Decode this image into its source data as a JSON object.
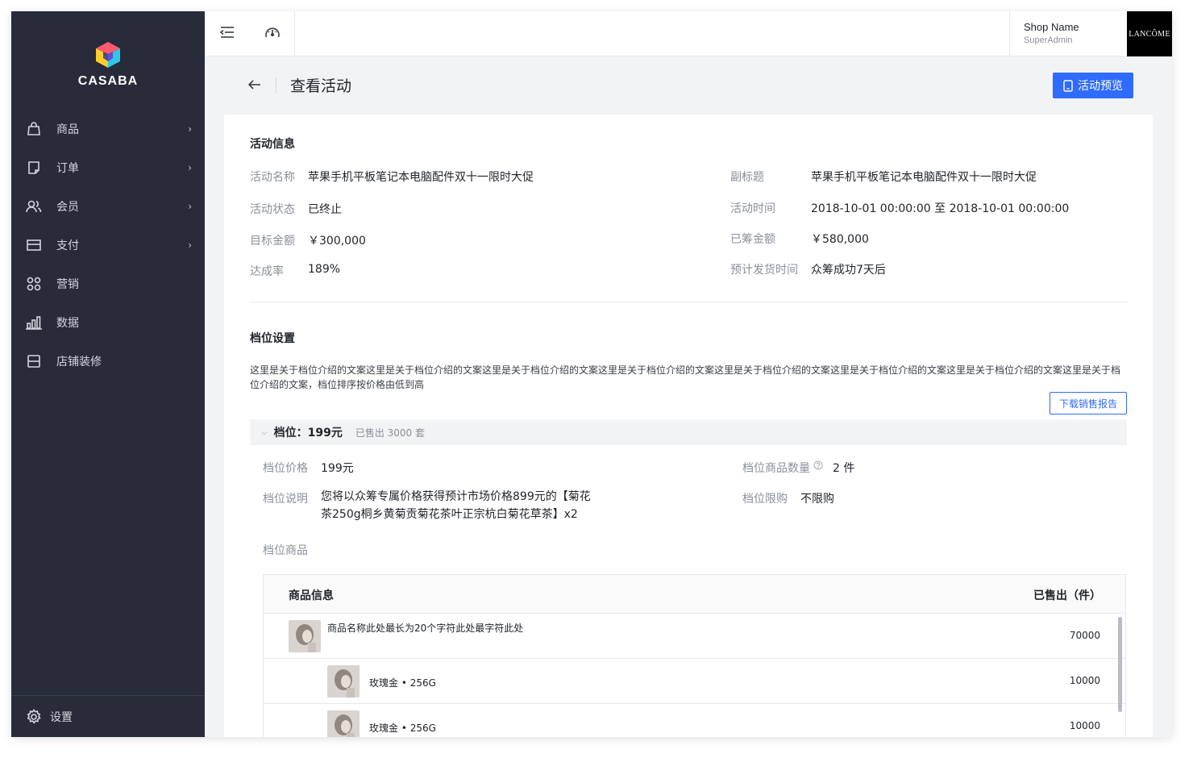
{
  "brand": {
    "logo_text": "CASABA"
  },
  "sidebar": {
    "items": [
      {
        "label": "商品",
        "icon": "shopping-bag-icon",
        "has_children": true
      },
      {
        "label": "订单",
        "icon": "order-doc-icon",
        "has_children": true
      },
      {
        "label": "会员",
        "icon": "members-icon",
        "has_children": true
      },
      {
        "label": "支付",
        "icon": "card-icon",
        "has_children": true
      },
      {
        "label": "营销",
        "icon": "apps-icon",
        "has_children": false
      },
      {
        "label": "数据",
        "icon": "bar-chart-icon",
        "has_children": false
      },
      {
        "label": "店铺装修",
        "icon": "layout-icon",
        "has_children": false
      }
    ],
    "settings_label": "设置"
  },
  "topbar": {
    "shop_name": "Shop Name",
    "shop_role": "SuperAdmin",
    "brand_logo_text": "LANCÔME"
  },
  "page": {
    "title": "查看活动",
    "preview_button": "活动预览"
  },
  "activity": {
    "section_title": "活动信息",
    "name_label": "活动名称",
    "name_value": "苹果手机平板笔记本电脑配件双十一限时大促",
    "subtitle_label": "副标题",
    "subtitle_value": "苹果手机平板笔记本电脑配件双十一限时大促",
    "status_label": "活动状态",
    "status_value": "已终止",
    "time_label": "活动时间",
    "time_value": "2018-10-01 00:00:00 至 2018-10-01 00:00:00",
    "target_label": "目标金额",
    "target_value": "￥300,000",
    "raised_label": "已筹金额",
    "raised_value": "￥580,000",
    "rate_label": "达成率",
    "rate_value": "189%",
    "ship_label": "预计发货时间",
    "ship_value": "众筹成功7天后"
  },
  "tiers": {
    "section_title": "档位设置",
    "intro": "这里是关于档位介绍的文案这里是关于档位介绍的文案这里是关于档位介绍的文案这里是关于档位介绍的文案这里是关于档位介绍的文案这里是关于档位介绍的文案这里是关于档位介绍的文案这里是关于档位介绍的文案，档位排序按价格由低到高",
    "download_button": "下载销售报告",
    "tier": {
      "name": "档位：199元",
      "sold": "已售出 3000 套",
      "price_label": "档位价格",
      "price_value": "199元",
      "qty_label": "档位商品数量",
      "qty_value": "2 件",
      "desc_label": "档位说明",
      "desc_line1": "您将以众筹专属价格获得预计市场价格899元的【菊花",
      "desc_line2": "茶250g桐乡黄菊贡菊花茶叶正宗杭白菊花草茶】x2",
      "limit_label": "档位限购",
      "limit_value": "不限购",
      "goods_label": "档位商品"
    },
    "table": {
      "col_info": "商品信息",
      "col_sold": "已售出（件）",
      "rows": [
        {
          "name": "商品名称此处最长为20个字符此处最字符此处",
          "sold": "70000",
          "level": 0
        },
        {
          "name": "玫瑰金 • 256G",
          "sold": "10000",
          "level": 1
        },
        {
          "name": "玫瑰金 • 256G",
          "sold": "10000",
          "level": 1
        }
      ]
    }
  }
}
